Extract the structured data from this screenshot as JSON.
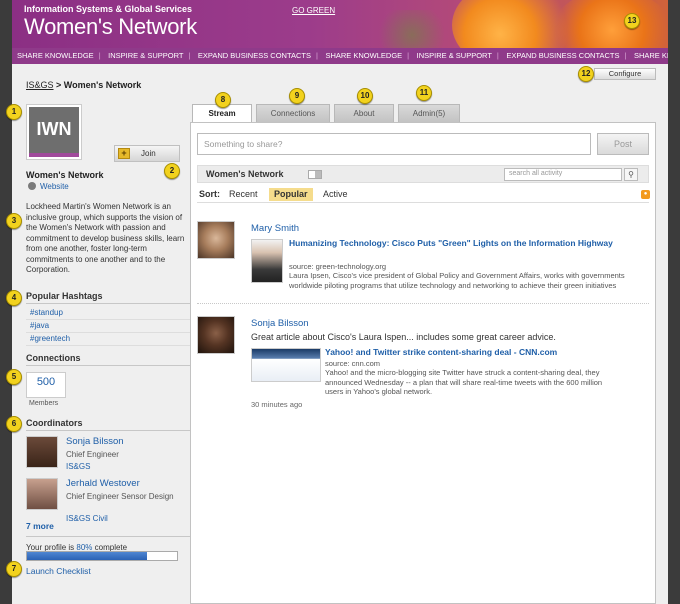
{
  "header": {
    "org": "Information Systems & Global Services",
    "title": "Women's Network",
    "go_green": "GO GREEN",
    "nav": [
      "SHARE KNOWLEDGE",
      "INSPIRE & SUPPORT",
      "EXPAND BUSINESS CONTACTS",
      "SHARE KNOWLEDGE",
      "INSPIRE & SUPPORT",
      "EXPAND BUSINESS CONTACTS",
      "SHARE KNOWLEDGE"
    ]
  },
  "configure_label": "Configure",
  "breadcrumb": {
    "root": "IS&GS",
    "sep": " > ",
    "current": "Women's Network"
  },
  "sidebar": {
    "logo_text": "IWN",
    "join_label": "Join",
    "join_icon": "+",
    "group_name": "Women's Network",
    "website_label": "Website",
    "description": "Lockheed Martin's Women Network is an inclusive group, which supports the vision of the Women's Network with passion and commitment to develop business skills, learn from one another, foster long-term commitments to one another and to the Corporation.",
    "hashtags_title": "Popular Hashtags",
    "hashtags": [
      "#standup",
      "#java",
      "#greentech"
    ],
    "connections_title": "Connections",
    "connections_count": "500",
    "connections_label": "Members",
    "coordinators_title": "Coordinators",
    "coordinators": [
      {
        "name": "Sonja Bilsson",
        "role": "Chief Engineer",
        "org": "IS&GS"
      },
      {
        "name": "Jerhald Westover",
        "role": "Chief Engineer Sensor Design",
        "org": "IS&GS Civil"
      }
    ],
    "more_label": "7 more",
    "profile_prefix": "Your profile is ",
    "profile_percent": "80%",
    "profile_suffix": " complete",
    "profile_progress": 0.8,
    "launch_label": "Launch Checklist"
  },
  "tabs": [
    {
      "label": "Stream",
      "active": true
    },
    {
      "label": "Connections",
      "active": false
    },
    {
      "label": "About",
      "active": false
    },
    {
      "label": "Admin(5)",
      "active": false
    }
  ],
  "markers": [
    "1",
    "2",
    "3",
    "4",
    "5",
    "6",
    "7",
    "8",
    "9",
    "10",
    "11",
    "12",
    "13"
  ],
  "stream": {
    "share_placeholder": "Something to share?",
    "post_label": "Post",
    "feed_name": "Women's Network",
    "search_placeholder": "search all activity",
    "sort_label": "Sort:",
    "sort_options": [
      "Recent",
      "Popular",
      "Active"
    ],
    "posts": [
      {
        "author": "Mary Smith",
        "headline": "Humanizing Technology: Cisco Puts \"Green\" Lights on the Information Highway",
        "source": "source: green-technology.org",
        "body": "Laura Ipsen, Cisco's vice president of Global Policy and Government Affairs, works with governments worldwide piloting programs that utilize technology and networking to achieve their green initiatives"
      },
      {
        "author": "Sonja Bilsson",
        "message": "Great article about Cisco's Laura Ispen... includes some great career advice.",
        "headline": "Yahoo! and Twitter strike content-sharing deal - CNN.com",
        "source": "source: cnn.com",
        "body": "Yahoo! and the micro-blogging site Twitter have struck a content-sharing deal, they announced Wednesday -- a plan that will share real-time tweets with the 600 million users in Yahoo's global network.",
        "time": "30 minutes ago"
      }
    ]
  },
  "colors": {
    "brand_purple": "#8f3a8a",
    "link_blue": "#1f5fa8",
    "marker_yellow": "#f2d21e",
    "popular_highlight": "#f5dc8c"
  }
}
